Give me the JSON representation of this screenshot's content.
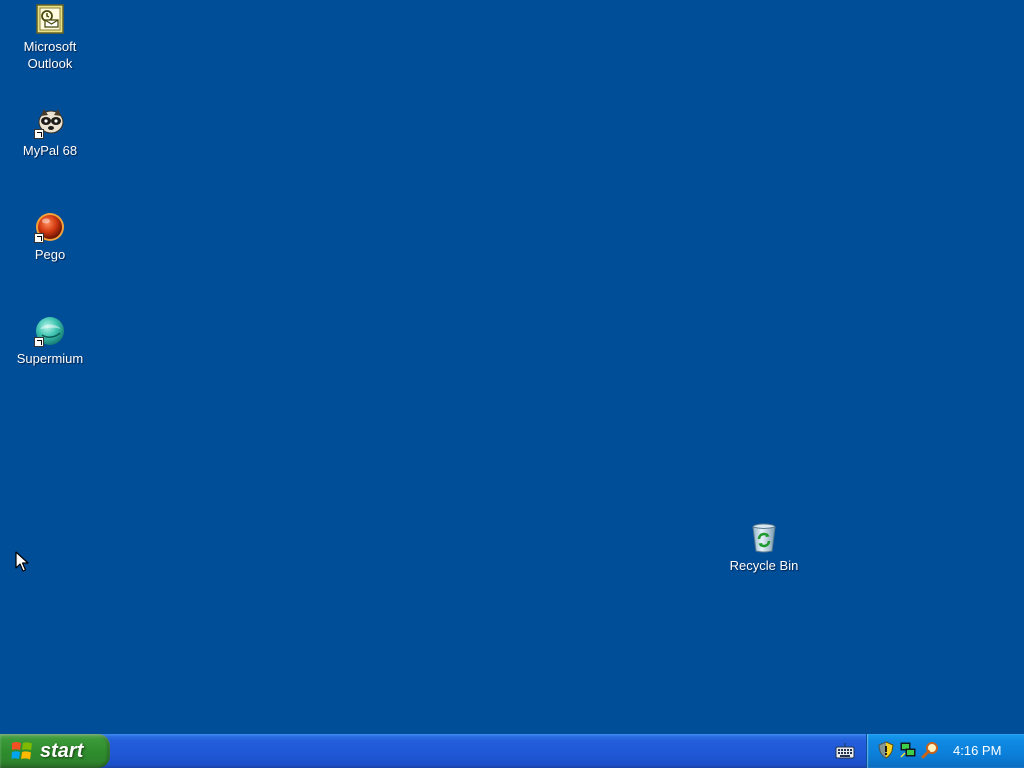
{
  "desktop": {
    "background_color": "#004e98",
    "icons": [
      {
        "label": "Microsoft\nOutlook",
        "icon": "outlook-icon",
        "shortcut": false
      },
      {
        "label": "MyPal 68",
        "icon": "mypal-icon",
        "shortcut": true
      },
      {
        "label": "Pego",
        "icon": "pego-icon",
        "shortcut": true
      },
      {
        "label": "Supermium",
        "icon": "supermium-icon",
        "shortcut": true
      },
      {
        "label": "Recycle Bin",
        "icon": "recycle-bin-icon",
        "shortcut": false
      }
    ]
  },
  "taskbar": {
    "start_label": "start",
    "input_indicator_icon": "keyboard-icon",
    "tray_icons": [
      "security-shield-icon",
      "network-icon",
      "search-icon"
    ],
    "clock": "4:16 PM"
  }
}
